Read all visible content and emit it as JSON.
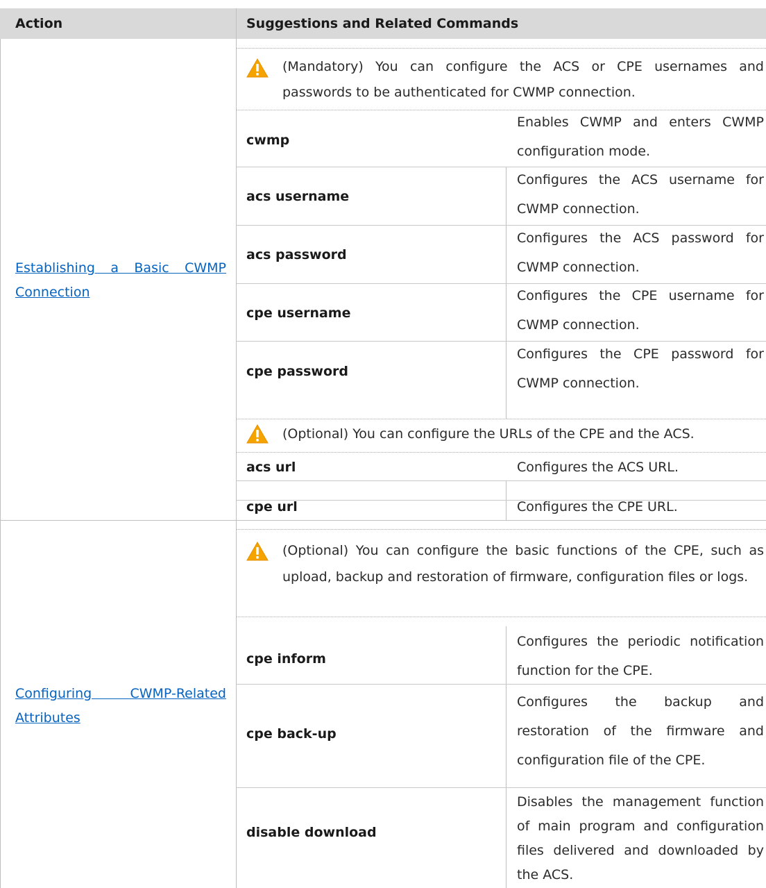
{
  "table": {
    "headers": {
      "action": "Action",
      "suggestions": "Suggestions and Related Commands"
    },
    "sections": [
      {
        "action": "Establishing a Basic CWMP Connection",
        "notes": [
          "(Mandatory) You can configure the ACS or CPE usernames and passwords to be authenticated for CWMP connection.",
          "(Optional) You can configure the URLs of the CPE and the ACS."
        ],
        "commands": [
          {
            "cmd": "cwmp",
            "desc": "Enables CWMP and enters CWMP configuration mode."
          },
          {
            "cmd": "acs username",
            "desc": "Configures the ACS username for CWMP connection."
          },
          {
            "cmd": "acs password",
            "desc": "Configures the ACS password for CWMP connection."
          },
          {
            "cmd": "cpe username",
            "desc": "Configures the CPE username for CWMP connection."
          },
          {
            "cmd": "cpe password",
            "desc": "Configures the CPE password for CWMP connection."
          },
          {
            "cmd": "acs url",
            "desc": "Configures the ACS URL."
          },
          {
            "cmd": "cpe url",
            "desc": "Configures the CPE URL."
          }
        ]
      },
      {
        "action": "Configuring CWMP-Related Attributes",
        "notes": [
          "(Optional) You can configure the basic functions of the CPE, such as upload, backup and restoration of firmware, configuration files or logs."
        ],
        "commands": [
          {
            "cmd": "cpe inform",
            "desc": "Configures the periodic notification function for the CPE."
          },
          {
            "cmd": "cpe back-up",
            "desc": "Configures the backup and restoration of the firmware and configuration file of the CPE."
          },
          {
            "cmd": "disable download",
            "desc": "Disables the management function of main program and configuration files delivered and downloaded by the ACS."
          }
        ]
      }
    ]
  },
  "icons": {
    "warning": "warning-triangle-icon"
  },
  "colors": {
    "header_bg": "#d9d9d9",
    "link": "#0563c1",
    "warning_fill": "#f5a300"
  }
}
